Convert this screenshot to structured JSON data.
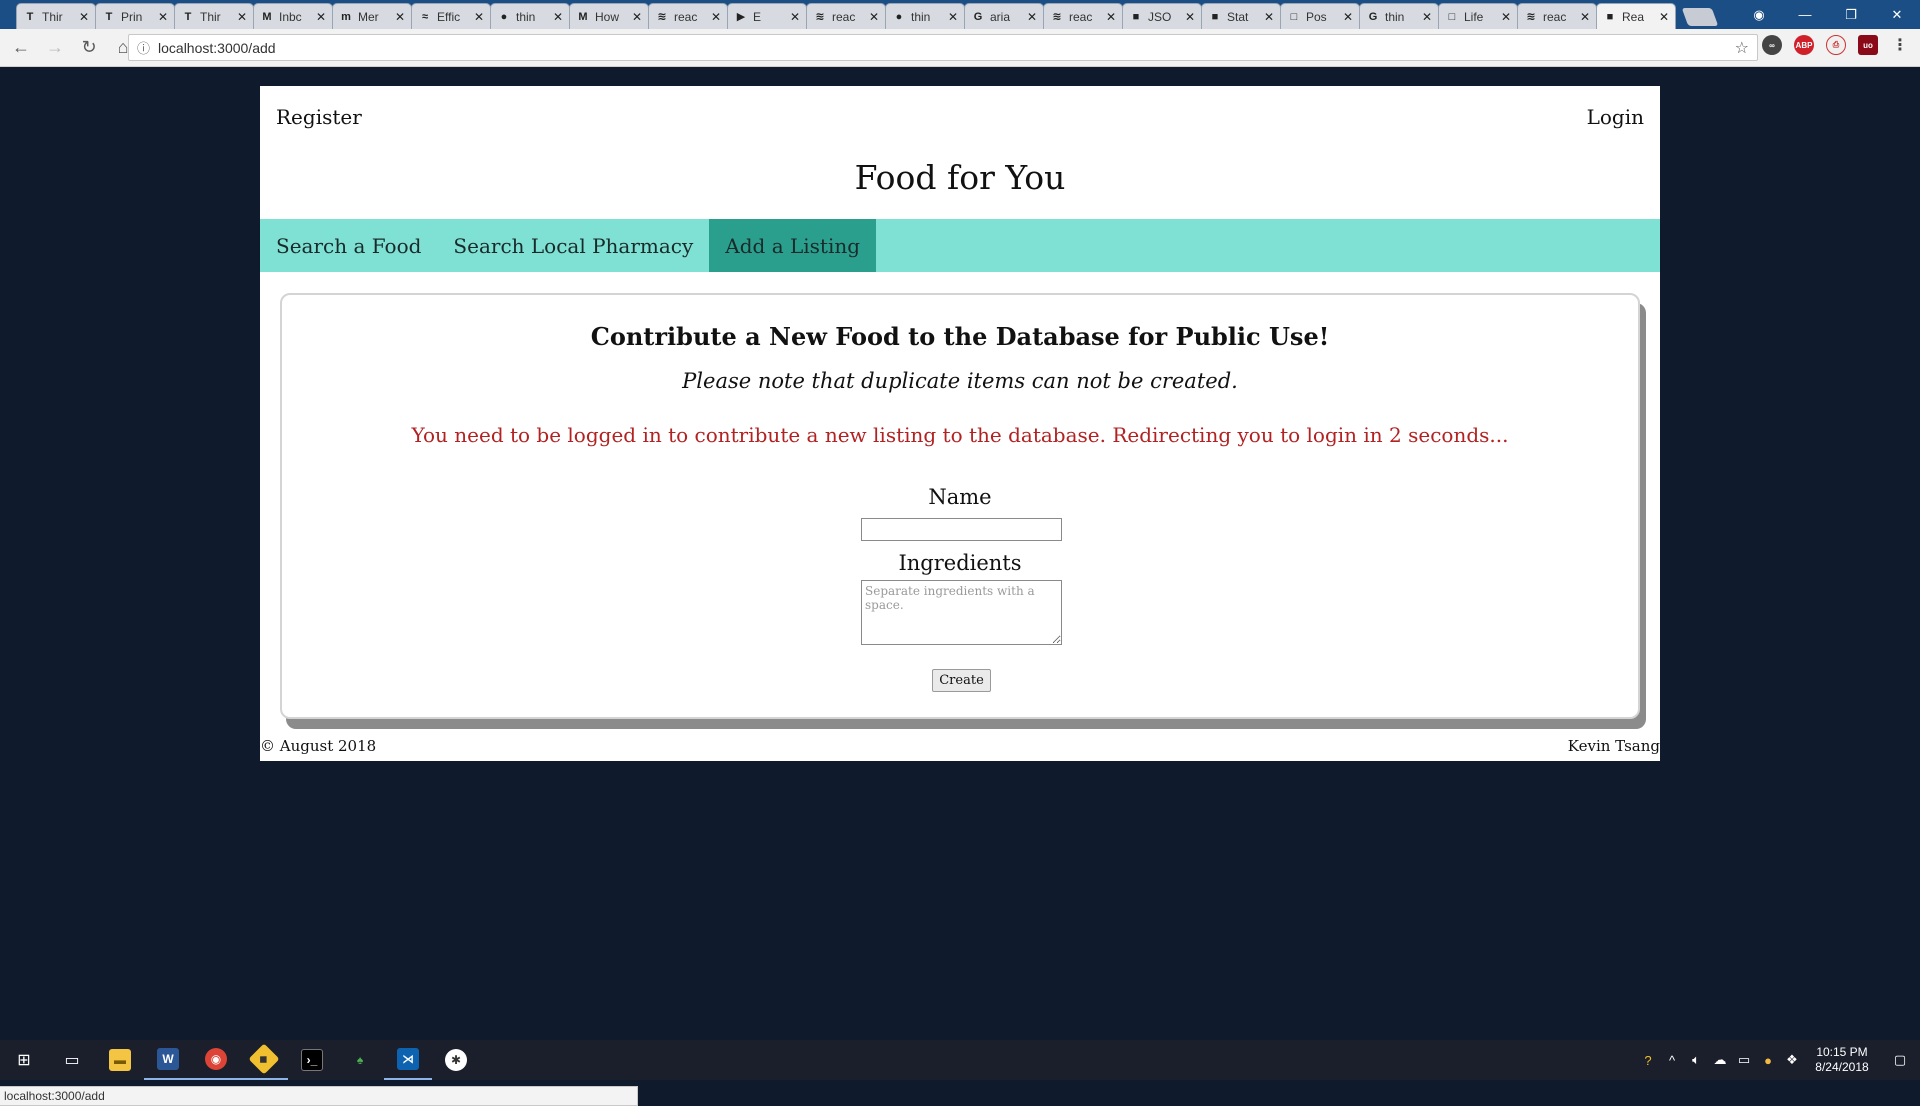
{
  "browser": {
    "tabs": [
      {
        "label": "Thir",
        "icon": "T"
      },
      {
        "label": "Prin",
        "icon": "T"
      },
      {
        "label": "Thir",
        "icon": "T"
      },
      {
        "label": "Inbc",
        "icon": "M"
      },
      {
        "label": "Mer",
        "icon": "m"
      },
      {
        "label": "Effic",
        "icon": "≈"
      },
      {
        "label": "thin",
        "icon": "●"
      },
      {
        "label": "How",
        "icon": "M"
      },
      {
        "label": "reac",
        "icon": "≋"
      },
      {
        "label": "E",
        "icon": "▶"
      },
      {
        "label": "reac",
        "icon": "≋"
      },
      {
        "label": "thin",
        "icon": "●"
      },
      {
        "label": "aria",
        "icon": "G"
      },
      {
        "label": "reac",
        "icon": "≋"
      },
      {
        "label": "JSO",
        "icon": "■"
      },
      {
        "label": "Stat",
        "icon": "■"
      },
      {
        "label": "Pos",
        "icon": "□"
      },
      {
        "label": "thin",
        "icon": "G"
      },
      {
        "label": "Life",
        "icon": "□"
      },
      {
        "label": "reac",
        "icon": "≋"
      },
      {
        "label": "Rea",
        "icon": "■"
      }
    ],
    "close_glyph": "✕",
    "url": "localhost:3000/add",
    "status_url": "localhost:3000/add"
  },
  "site": {
    "register": "Register",
    "login": "Login",
    "title": "Food for You",
    "nav": [
      {
        "label": "Search a Food",
        "active": false
      },
      {
        "label": "Search Local Pharmacy",
        "active": false
      },
      {
        "label": "Add a Listing",
        "active": true
      }
    ],
    "form": {
      "heading": "Contribute a New Food to the Database for Public Use!",
      "note": "Please note that duplicate items can not be created.",
      "warning": "You need to be logged in to contribute a new listing to the database. Redirecting you to login in 2 seconds...",
      "name_label": "Name",
      "name_value": "",
      "ingredients_label": "Ingredients",
      "ingredients_placeholder": "Separate ingredients with a space.",
      "create_label": "Create"
    },
    "footer": {
      "left": "© August 2018",
      "right": "Kevin Tsang"
    }
  },
  "taskbar": {
    "time": "10:15 PM",
    "date": "8/24/2018"
  },
  "colors": {
    "nav_bg": "#7fe0d4",
    "nav_active": "#2a9f8d",
    "warning": "#b22222",
    "page_bg": "#0f1b2d"
  }
}
